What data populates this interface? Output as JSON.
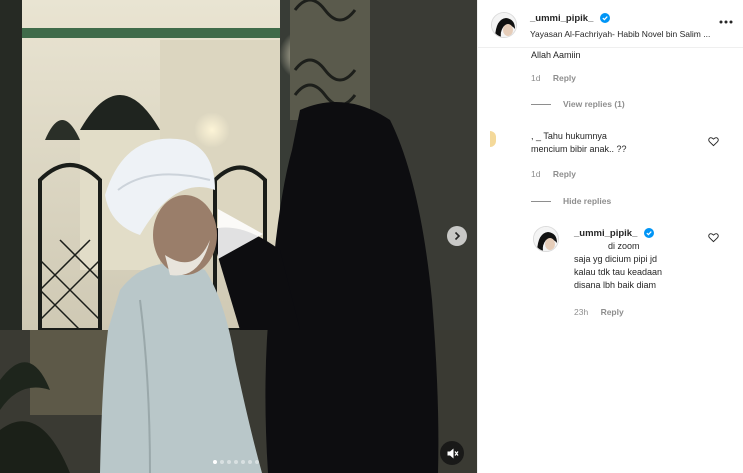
{
  "post": {
    "username": "_ummi_pipik_",
    "location": "Yayasan Al-Fachriyah- Habib Novel bin Salim ..."
  },
  "media": {
    "slide_count": 7,
    "active_slide": 1,
    "icons": {
      "play": "play-icon",
      "next": "chevron-right-icon",
      "mute": "speaker-muted-icon"
    }
  },
  "comments": [
    {
      "text": "Allah Aamiin",
      "time": "1d",
      "reply_label": "Reply",
      "thread_label": "View replies (1)"
    },
    {
      "text_line1": ", _ Tahu hukumnya",
      "text_line2": "mencium bibir anak.. ??",
      "time": "1d",
      "reply_label": "Reply",
      "thread_label": "Hide replies",
      "replies": [
        {
          "username": "_ummi_pipik_",
          "lines": [
            "di zoom",
            "saja yg dicium pipi jd",
            "kalau tdk tau keadaan",
            "disana lbh baik diam"
          ],
          "time": "23h",
          "reply_label": "Reply"
        }
      ]
    }
  ],
  "colors": {
    "accent": "#0095f6",
    "muted": "#8e8e8e",
    "text": "#262626"
  }
}
